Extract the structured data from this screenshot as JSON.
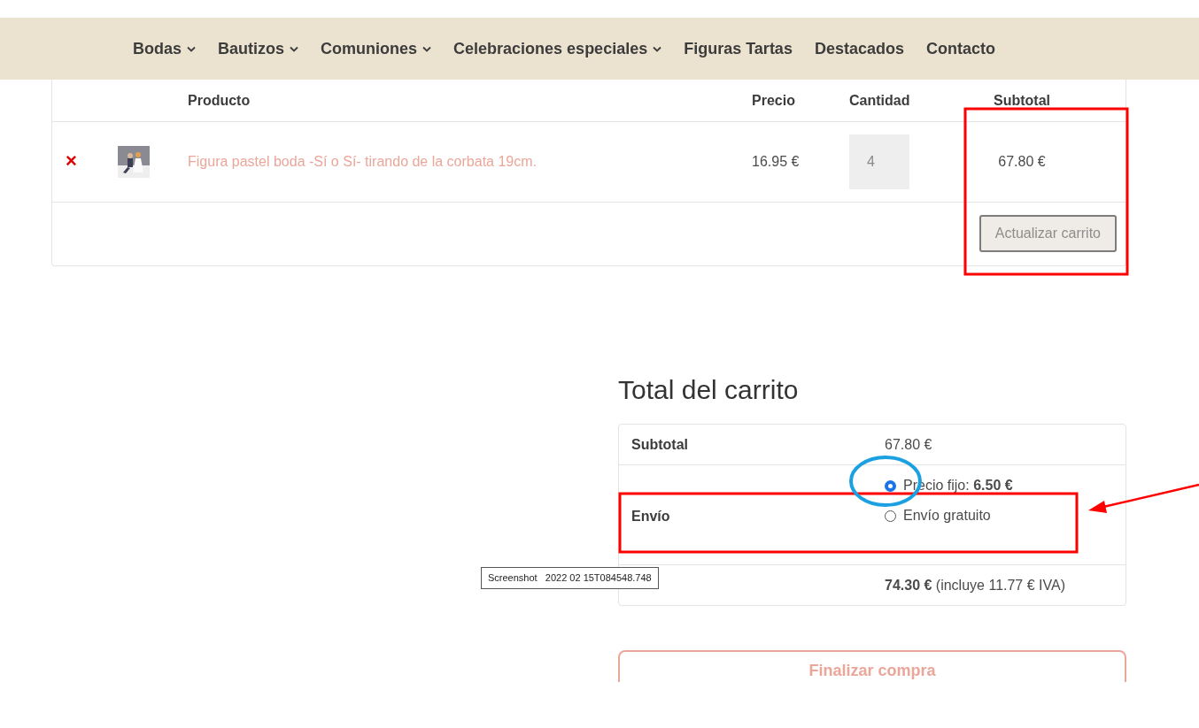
{
  "nav": [
    {
      "label": "Bodas",
      "dropdown": true
    },
    {
      "label": "Bautizos",
      "dropdown": true
    },
    {
      "label": "Comuniones",
      "dropdown": true
    },
    {
      "label": "Celebraciones especiales",
      "dropdown": true
    },
    {
      "label": "Figuras Tartas",
      "dropdown": false
    },
    {
      "label": "Destacados",
      "dropdown": false
    },
    {
      "label": "Contacto",
      "dropdown": false
    }
  ],
  "cart": {
    "columns": [
      "Producto",
      "Precio",
      "Cantidad",
      "Subtotal"
    ],
    "rows": [
      {
        "remove": "×",
        "product": "Figura pastel boda -Sí o Sí- tirando de la corbata 19cm.",
        "price": "16.95 €",
        "quantity": "4",
        "subtotal": "67.80 €"
      }
    ],
    "update_button": "Actualizar carrito"
  },
  "totals": {
    "title": "Total del carrito",
    "subtotal_label": "Subtotal",
    "subtotal": "67.80 €",
    "shipping_label": "Envío",
    "shipping_options": [
      {
        "label": "Precio fijo: **6.50 €**",
        "selected": true
      },
      {
        "label": "Envío gratuito",
        "selected": false
      }
    ],
    "total": "**74.30 €** (incluye 11.77 € IVA)",
    "checkout_button": "Finalizar compra"
  },
  "tooltip": "Screenshot   2022 02 15T084548.748"
}
